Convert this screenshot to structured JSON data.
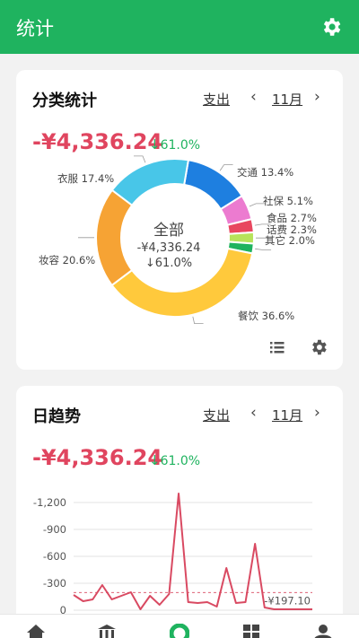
{
  "app": {
    "title": "统计"
  },
  "category_card": {
    "title": "分类统计",
    "type": "支出",
    "month": "11月",
    "prev": "‹",
    "next": "›",
    "amount": "-¥4,336.24",
    "change_arrow": "↓",
    "change": "61.0%",
    "center": {
      "line1": "全部",
      "line2": "-¥4,336.24",
      "line3": "↓61.0%"
    },
    "chart_data": {
      "type": "pie",
      "slices": [
        {
          "name": "交通",
          "value": 13.4,
          "color": "#1e7fe0"
        },
        {
          "name": "社保",
          "value": 5.1,
          "color": "#ec7bd0"
        },
        {
          "name": "食品",
          "value": 2.7,
          "color": "#e8475f"
        },
        {
          "name": "话费",
          "value": 2.3,
          "color": "#b7e35a"
        },
        {
          "name": "其它",
          "value": 2.0,
          "color": "#1fb35f"
        },
        {
          "name": "餐饮",
          "value": 36.6,
          "color": "#ffc93c"
        },
        {
          "name": "妆容",
          "value": 20.6,
          "color": "#f6a334"
        },
        {
          "name": "衣服",
          "value": 17.4,
          "color": "#48c6e8"
        }
      ]
    },
    "labels": {
      "jiaotong": "交通 13.4%",
      "shebao": "社保 5.1%",
      "shipin": "食品 2.7%",
      "huafei": "话费 2.3%",
      "qita": "其它 2.0%",
      "canyin": "餐饮 36.6%",
      "zhuangrong": "妆容 20.6%",
      "yifu": "衣服 17.4%"
    }
  },
  "daily_card": {
    "title": "日趋势",
    "type": "支出",
    "month": "11月",
    "prev": "‹",
    "next": "›",
    "amount": "-¥4,336.24",
    "change_arrow": "↓",
    "change": "61.0%",
    "average_label": "-¥197.10",
    "chart_data": {
      "type": "line",
      "yticks": [
        "-1,200",
        "-900",
        "-600",
        "-300",
        "0"
      ],
      "ylim": [
        0,
        -1300
      ],
      "average": -197.1,
      "values": [
        -170,
        -100,
        -120,
        -280,
        -120,
        -160,
        -200,
        -10,
        -160,
        -60,
        -180,
        -1300,
        -90,
        -80,
        -90,
        -40,
        -470,
        -80,
        -90,
        -740,
        -30,
        -10,
        -10,
        -10,
        -10,
        -10
      ],
      "color": "#d94a62"
    }
  },
  "icons": {
    "settings": "gear-icon",
    "list": "list-icon",
    "card_settings": "gear-icon"
  },
  "nav": [
    "home-icon",
    "bank-icon",
    "stats-icon",
    "grid-icon",
    "profile-icon"
  ]
}
